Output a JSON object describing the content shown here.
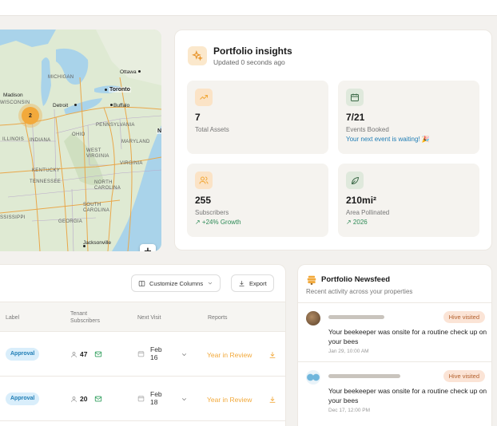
{
  "map": {
    "cluster_count": "2",
    "labels": {
      "wisconsin": "WISCONSIN",
      "michigan": "MICHIGAN",
      "illinois": "ILLINOIS",
      "indiana": "INDIANA",
      "ohio": "OHIO",
      "pennsylvania": "PENNSYLVANIA",
      "west_virginia": "WEST\nVIRGINIA",
      "maryland": "MARYLAND",
      "virginia": "VIRGINIA",
      "kentucky": "KENTUCKY",
      "tennessee": "TENNESSEE",
      "north_carolina": "NORTH\nCAROLINA",
      "south_carolina": "SOUTH\nCAROLINA",
      "georgia": "GEORGIA",
      "mississippi": "SSISSIPPI"
    },
    "cities": {
      "ottawa": "Ottawa",
      "toronto": "Toronto",
      "madison": "Madison",
      "detroit": "Detroit",
      "buffalo": "Buffalo",
      "jacksonville": "Jacksonville",
      "ny_short": "N"
    },
    "zoom_in": "+",
    "zoom_out": "−"
  },
  "insights": {
    "title": "Portfolio insights",
    "subtitle": "Updated 0 seconds ago",
    "tiles": [
      {
        "value": "7",
        "label": "Total Assets",
        "note": "",
        "icon": "trending-up-icon"
      },
      {
        "value": "7/21",
        "label": "Events Booked",
        "note": "Your next event is waiting! 🎉",
        "icon": "calendar-icon"
      },
      {
        "value": "255",
        "label": "Subscribers",
        "note": "↗ +24% Growth",
        "icon": "users-icon"
      },
      {
        "value": "210mi²",
        "label": "Area Pollinated",
        "note": "↗ 2026",
        "icon": "leaf-icon"
      }
    ],
    "colors": {
      "note_blue": "#1f7db5",
      "note_green": "#2e8b57",
      "accent": "#f2a93b"
    }
  },
  "table": {
    "customize_label": "Customize Columns",
    "export_label": "Export",
    "headers": {
      "label": "Label",
      "tenant": "Tenant\nSubscribers",
      "next_visit": "Next Visit",
      "reports": "Reports"
    },
    "rows": [
      {
        "label": "Approval",
        "subscribers": "47",
        "visit_month": "Feb",
        "visit_day": "16",
        "report": "Year in Review"
      },
      {
        "label": "Approval",
        "subscribers": "20",
        "visit_month": "Feb",
        "visit_day": "18",
        "report": "Year in Review"
      }
    ]
  },
  "news": {
    "title": "Portfolio Newsfeed",
    "subtitle": "Recent activity across your properties",
    "items": [
      {
        "badge": "Hive visited",
        "text": "Your beekeeper was onsite for a routine check up on your bees",
        "time": "Jan 29, 10:00 AM"
      },
      {
        "badge": "Hive visited",
        "text": "Your beekeeper was onsite for a routine check up on your bees",
        "time": "Dec 17, 12:00 PM"
      }
    ]
  }
}
